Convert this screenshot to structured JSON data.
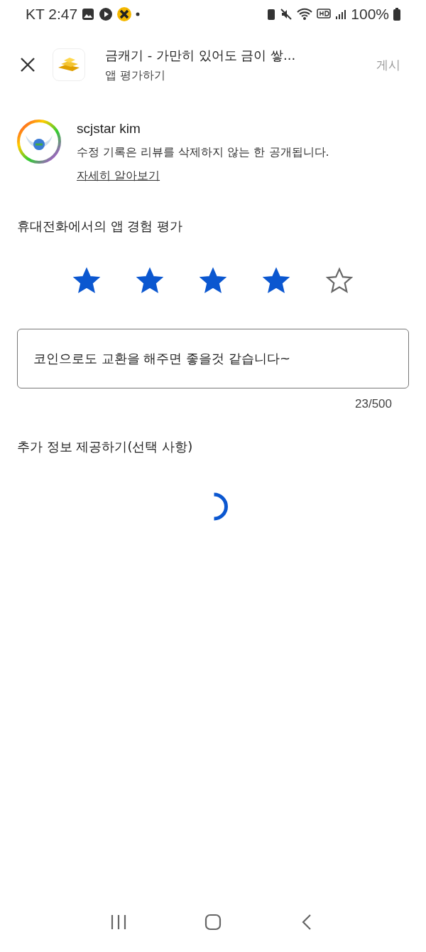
{
  "status_bar": {
    "carrier_time": "KT 2:47",
    "battery": "100%"
  },
  "header": {
    "app_title": "금캐기 - 가만히 있어도 금이 쌓...",
    "subtitle": "앱 평가하기",
    "post_button": {
      "label": "게시",
      "disabled": true
    }
  },
  "user": {
    "name": "scjstar kim",
    "notice": "수정 기록은 리뷰를 삭제하지 않는 한 공개됩니다.",
    "learn_more": "자세히 알아보기"
  },
  "rating": {
    "heading": "휴대전화에서의 앱 경험 평가",
    "stars": 4
  },
  "review": {
    "value": "코인으로도 교환을 해주면 좋을것 같습니다~",
    "counter": "23/500"
  },
  "extra": {
    "heading": "추가 정보 제공하기(선택 사항)",
    "loading": true
  }
}
